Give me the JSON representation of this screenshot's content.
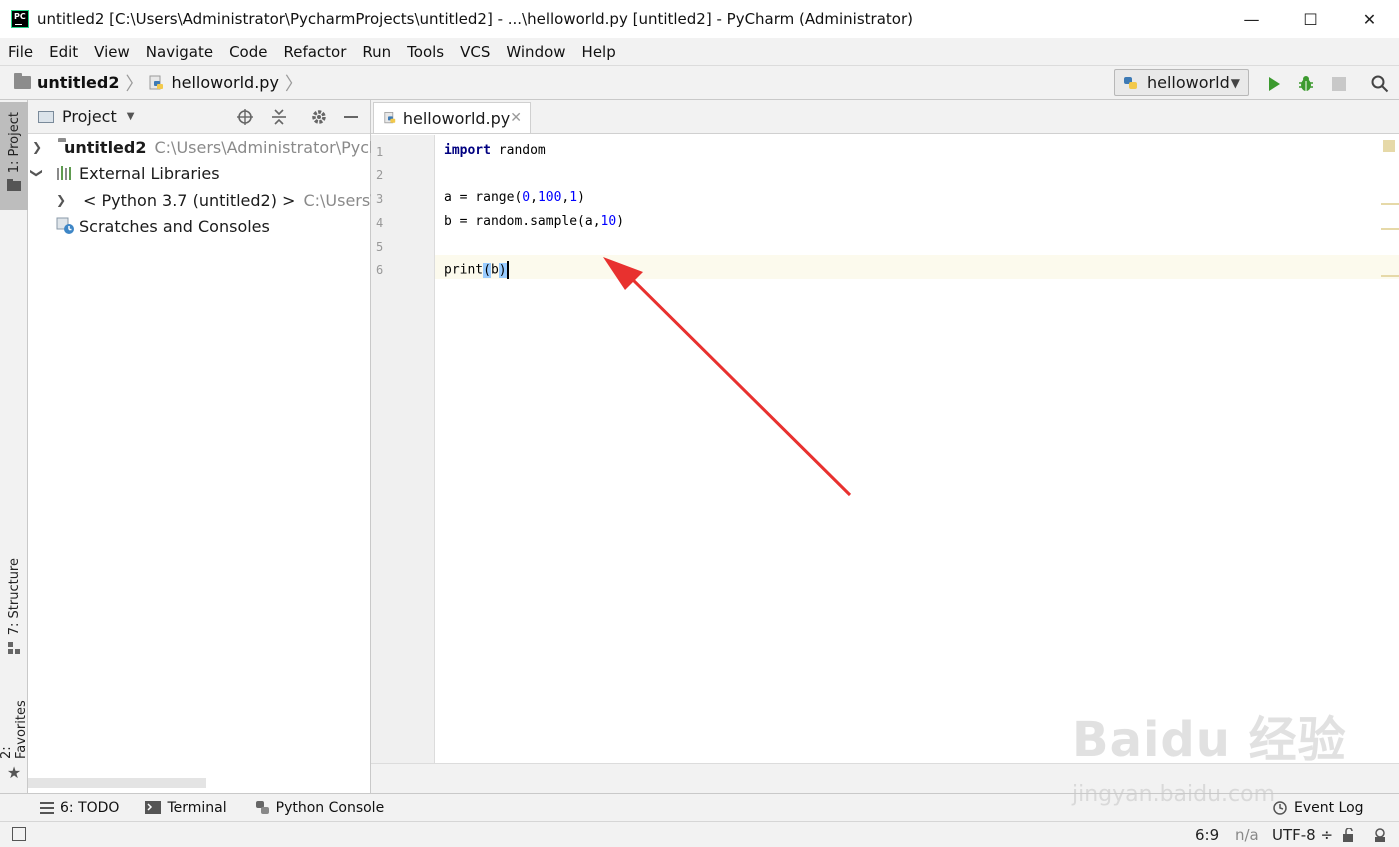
{
  "window": {
    "title": "untitled2 [C:\\Users\\Administrator\\PycharmProjects\\untitled2] - ...\\helloworld.py [untitled2] - PyCharm (Administrator)",
    "logo_text": "PC",
    "minimize": "—",
    "maximize": "☐",
    "close": "✕"
  },
  "menu": [
    "File",
    "Edit",
    "View",
    "Navigate",
    "Code",
    "Refactor",
    "Run",
    "Tools",
    "VCS",
    "Window",
    "Help"
  ],
  "breadcrumb": {
    "project": "untitled2",
    "file": "helloworld.py"
  },
  "run_config": {
    "name": "helloworld"
  },
  "left_strip": {
    "project_tab": "1: Project",
    "structure_tab": "7: Structure",
    "favorites_tab": "2: Favorites"
  },
  "project_panel": {
    "title": "Project",
    "tree": {
      "root_name": "untitled2",
      "root_path": "C:\\Users\\Administrator\\Pycha",
      "external_libraries": "External Libraries",
      "python_sdk": "< Python 3.7 (untitled2) >",
      "python_sdk_path": "C:\\Users\\A",
      "scratches": "Scratches and Consoles"
    }
  },
  "editor": {
    "tab_label": "helloworld.py",
    "line_numbers": [
      "1",
      "2",
      "3",
      "4",
      "5",
      "6"
    ],
    "code": {
      "l1_kw": "import",
      "l1_rest": " random",
      "l3_a": "a = range(",
      "l3_n1": "0",
      "l3_c1": ",",
      "l3_n2": "100",
      "l3_c2": ",",
      "l3_n3": "1",
      "l3_end": ")",
      "l4_a": "b = random.sample(a,",
      "l4_n": "10",
      "l4_end": ")",
      "l6_a": "print",
      "l6_p1": "(",
      "l6_b": "b",
      "l6_p2": ")"
    }
  },
  "bottom_toolbar": {
    "todo": "6: TODO",
    "terminal": "Terminal",
    "python_console": "Python Console",
    "event_log": "Event Log"
  },
  "statusbar": {
    "position": "6:9",
    "na": "n/a",
    "encoding": "UTF-8 ÷"
  },
  "watermark": {
    "main": "Baidu 经验",
    "sub": "jingyan.baidu.com"
  },
  "colors": {
    "run_green": "#3c9a2f",
    "arrow_red": "#e8312f",
    "current_line": "#fcfaed",
    "keyword": "#000080",
    "number": "#0000ff"
  }
}
